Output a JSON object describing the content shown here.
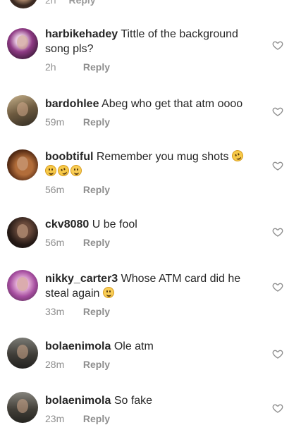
{
  "partial_top": {
    "time": "2h",
    "reply": "Reply"
  },
  "comments": [
    {
      "username": "harbikehadey",
      "text": "Tittle of the background song pls?",
      "time": "2h",
      "reply": "Reply"
    },
    {
      "username": "bardohlee",
      "text": "Abeg who get that atm oooo",
      "time": "59m",
      "reply": "Reply"
    },
    {
      "username": "boobtiful",
      "text": "Remember you mug shots",
      "emojis": [
        "rolling-on-floor-laughing-emoji",
        "grinning-sweat-emoji",
        "rolling-on-floor-laughing-emoji",
        "smirk-emoji"
      ],
      "time": "56m",
      "reply": "Reply"
    },
    {
      "username": "ckv8080",
      "text": "U be fool",
      "time": "56m",
      "reply": "Reply"
    },
    {
      "username": "nikky_carter3",
      "text": "Whose ATM card did he steal again",
      "emojis": [
        "relieved-emoji"
      ],
      "time": "33m",
      "reply": "Reply"
    },
    {
      "username": "bolaenimola",
      "text": "Ole atm",
      "time": "28m",
      "reply": "Reply"
    },
    {
      "username": "bolaenimola",
      "text": "So fake",
      "time": "23m",
      "reply": "Reply"
    }
  ],
  "icons": {
    "like": "heart-outline-icon"
  },
  "colors": {
    "text": "#262626",
    "meta": "#8e8e8e",
    "background": "#ffffff"
  }
}
